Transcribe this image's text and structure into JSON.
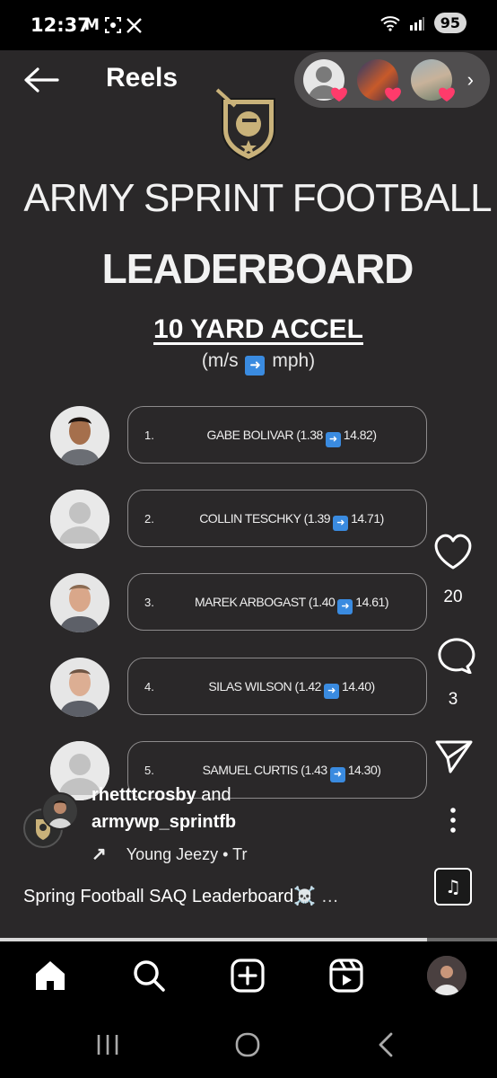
{
  "status_bar": {
    "time": "12:37",
    "left_icons": [
      "gmail-icon",
      "screenshot-icon",
      "x-icon"
    ],
    "battery": "95"
  },
  "top_bar": {
    "title": "Reels"
  },
  "post": {
    "headline_1": "ARMY SPRINT FOOTBALL",
    "headline_2": "LEADERBOARD",
    "subheading": "10 YARD ACCEL",
    "units_left": "(m/s",
    "units_right": "mph)",
    "leaderboard": [
      {
        "rank": "1.",
        "name": "GABE BOLIVAR",
        "ms": "(1.38",
        "mph": "14.82)"
      },
      {
        "rank": "2.",
        "name": "COLLIN TESCHKY",
        "ms": "(1.39",
        "mph": "14.71)"
      },
      {
        "rank": "3.",
        "name": "MAREK ARBOGAST",
        "ms": "(1.40",
        "mph": "14.61)"
      },
      {
        "rank": "4.",
        "name": "SILAS WILSON",
        "ms": "(1.42",
        "mph": "14.40)"
      },
      {
        "rank": "5.",
        "name": "SAMUEL CURTIS",
        "ms": "(1.43",
        "mph": "14.30)"
      }
    ]
  },
  "actions": {
    "likes": "20",
    "comments": "3"
  },
  "author": {
    "user_1": "rhetttcrosby",
    "and": "and",
    "user_2": "armywp_sprintfb",
    "music": "Young Jeezy • Tr",
    "caption": "Spring Football SAQ Leaderboard",
    "more": "…"
  },
  "playback": {
    "progress": 0.86
  },
  "colors": {
    "accent_arrow": "#3a8be0",
    "heart": "#ff3b6b",
    "reel_bg": "#2a2829"
  }
}
